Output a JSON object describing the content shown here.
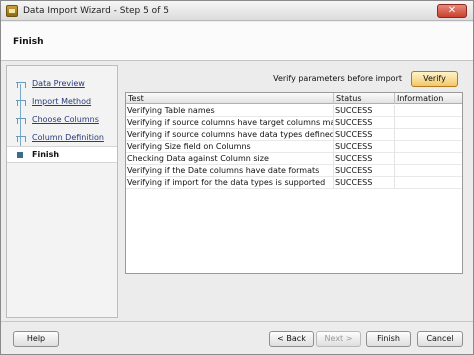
{
  "window": {
    "title": "Data Import Wizard - Step 5 of 5",
    "close_label": "✕"
  },
  "header": {
    "title": "Finish"
  },
  "sidebar": {
    "items": [
      {
        "label": "Data Preview"
      },
      {
        "label": "Import Method"
      },
      {
        "label": "Choose Columns"
      },
      {
        "label": "Column Definition"
      },
      {
        "label": "Finish"
      }
    ]
  },
  "main": {
    "verify_label": "Verify parameters before import",
    "verify_button": "Verify",
    "table": {
      "columns": [
        "Test",
        "Status",
        "Information"
      ],
      "rows": [
        [
          "Verifying Table names",
          "SUCCESS",
          ""
        ],
        [
          "Verifying if source columns have target columns mapped",
          "SUCCESS",
          ""
        ],
        [
          "Verifying if source columns have data types defined",
          "SUCCESS",
          ""
        ],
        [
          "Verifying Size field on Columns",
          "SUCCESS",
          ""
        ],
        [
          "Checking Data against Column size",
          "SUCCESS",
          ""
        ],
        [
          "Verifying if the Date columns have date formats",
          "SUCCESS",
          ""
        ],
        [
          "Verifying if import for the data types is supported",
          "SUCCESS",
          ""
        ]
      ]
    }
  },
  "footer": {
    "help": "Help",
    "back": "< Back",
    "next": "Next >",
    "finish": "Finish",
    "cancel": "Cancel"
  }
}
